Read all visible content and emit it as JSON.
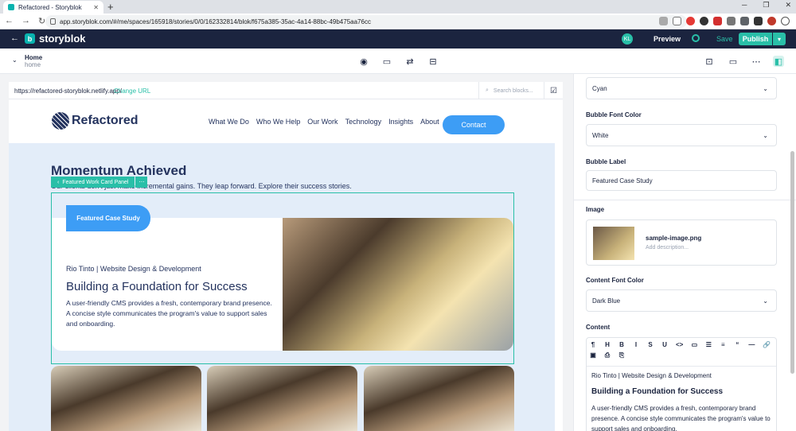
{
  "browser": {
    "tab_title": "Refactored - Storyblok",
    "url": "app.storyblok.com/#/me/spaces/165918/stories/0/0/162332814/blok/f675a385-35ac-4a14-88bc-49b475aa76cc"
  },
  "header": {
    "brand": "storyblok",
    "avatar_initials": "KL",
    "preview_label": "Preview",
    "save_label": "Save",
    "publish_label": "Publish"
  },
  "story": {
    "name": "Home",
    "slug": "home"
  },
  "frame": {
    "url": "https://refactored-storyblok.netlify.app/",
    "change_url": "Change URL",
    "search_placeholder": "Search blocks..."
  },
  "site": {
    "logo_text": "Refactored",
    "nav": [
      "What We Do",
      "Who We Help",
      "Our Work",
      "Technology",
      "Insights",
      "About"
    ],
    "contact_label": "Contact",
    "section_title": "Momentum Achieved",
    "section_sub": "Our clients don't just make incremental gains. They leap forward. Explore their success stories.",
    "block_label": "Featured Work Card Panel",
    "card": {
      "bubble": "Featured Case Study",
      "meta": "Rio Tinto | Website Design & Development",
      "title": "Building a Foundation for Success",
      "text": "A user-friendly CMS provides a fresh, contemporary brand presence. A concise style communicates the program's value to support sales and onboarding."
    }
  },
  "panel": {
    "bubble_color_value": "Cyan",
    "bubble_font_color_label": "Bubble Font Color",
    "bubble_font_color_value": "White",
    "bubble_label_label": "Bubble Label",
    "bubble_label_value": "Featured Case Study",
    "image_label": "Image",
    "image_name": "sample-image.png",
    "image_desc": "Add description...",
    "content_font_color_label": "Content Font Color",
    "content_font_color_value": "Dark Blue",
    "content_label": "Content",
    "rt_tools": [
      "¶",
      "H",
      "B",
      "I",
      "S",
      "U",
      "<>",
      "▭",
      "☰",
      "≡",
      "“",
      "—",
      "🔗",
      "▣",
      "⎙",
      "⎘"
    ],
    "rt_meta": "Rio Tinto | Website Design & Development",
    "rt_title": "Building a Foundation for Success",
    "rt_text": "A user-friendly CMS provides a fresh, contemporary brand presence. A concise style communicates the program's value to support sales and onboarding."
  },
  "colors": {
    "accent": "#29bfa8",
    "header_bg": "#1b243f",
    "site_blue": "#3d9df5"
  }
}
